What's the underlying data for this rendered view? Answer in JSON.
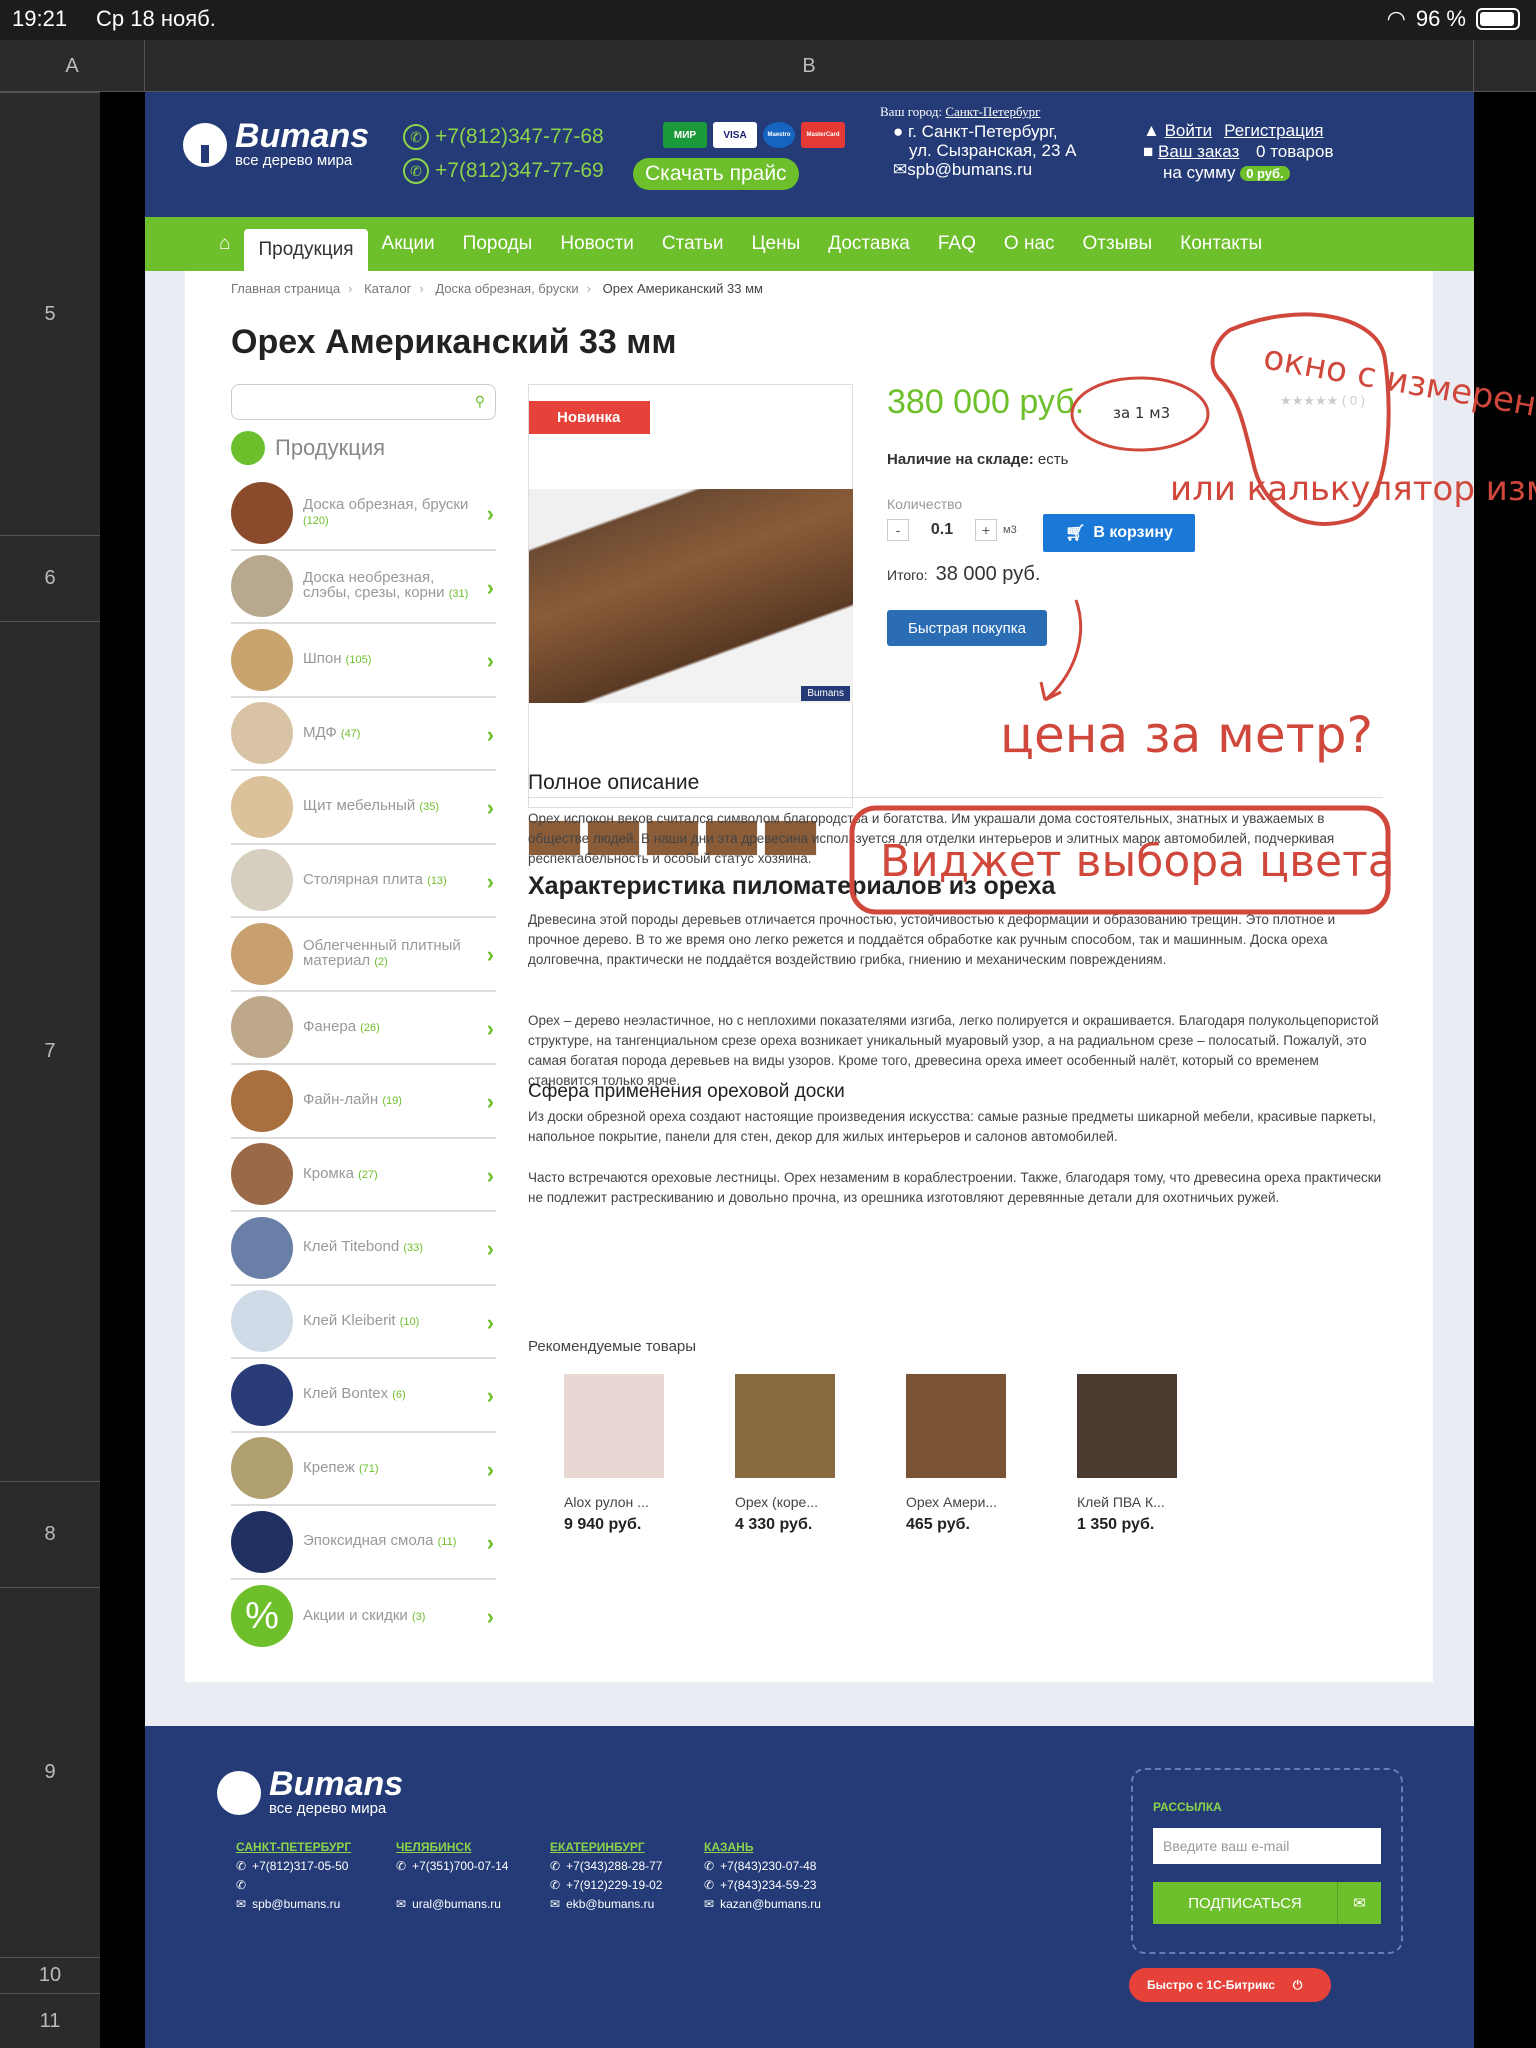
{
  "status_bar": {
    "time": "19:21",
    "date": "Ср 18 нояб.",
    "battery": "96 %"
  },
  "sheet": {
    "columns": [
      "A",
      "B"
    ],
    "rows": [
      "5",
      "6",
      "7",
      "8",
      "9",
      "10",
      "11"
    ]
  },
  "site": {
    "logo": {
      "name": "Bumans",
      "tagline": "все дерево мира"
    },
    "phones": [
      "+7(812)347-77-68",
      "+7(812)347-77-69"
    ],
    "payment_cards": [
      "МИР",
      "VISA",
      "Maestro",
      "MasterCard"
    ],
    "download_price": "Скачать прайс",
    "city_label": "Ваш город:",
    "city": "Санкт-Петербург",
    "address_line1": "г. Санкт-Петербург,",
    "address_line2": "ул. Сызранская, 23 А",
    "email": "spb@bumans.ru",
    "login": "Войти",
    "register": "Регистрация",
    "order_label": "Ваш заказ",
    "order_count": "0 товаров",
    "order_sum_label": "на сумму",
    "order_sum": "0 руб.",
    "nav": [
      "Продукция",
      "Акции",
      "Породы",
      "Новости",
      "Статьи",
      "Цены",
      "Доставка",
      "FAQ",
      "О нас",
      "Отзывы",
      "Контакты"
    ],
    "breadcrumbs": [
      "Главная страница",
      "Каталог",
      "Доска обрезная, бруски",
      "Орех Американский 33 мм"
    ],
    "title": "Орех Американский 33 мм",
    "catalog_title": "Продукция",
    "categories": [
      {
        "label": "Доска обрезная, бруски",
        "count": "(120)"
      },
      {
        "label": "Доска необрезная, слэбы, срезы, корни",
        "count": "(31)"
      },
      {
        "label": "Шпон",
        "count": "(105)"
      },
      {
        "label": "МДФ",
        "count": "(47)"
      },
      {
        "label": "Щит мебельный",
        "count": "(35)"
      },
      {
        "label": "Столярная плита",
        "count": "(13)"
      },
      {
        "label": "Облегченный плитный материал",
        "count": "(2)"
      },
      {
        "label": "Фанера",
        "count": "(26)"
      },
      {
        "label": "Файн-лайн",
        "count": "(19)"
      },
      {
        "label": "Кромка",
        "count": "(27)"
      },
      {
        "label": "Клей Titebond",
        "count": "(33)"
      },
      {
        "label": "Клей Kleiberit",
        "count": "(10)"
      },
      {
        "label": "Клей Bontex",
        "count": "(6)"
      },
      {
        "label": "Крепеж",
        "count": "(71)"
      },
      {
        "label": "Эпоксидная смола",
        "count": "(11)"
      },
      {
        "label": "Акции и скидки",
        "count": "(3)"
      }
    ],
    "badge_new": "Новинка",
    "watermark": "Bumans",
    "price": "380 000 руб.",
    "rating": "★★★★★ ( 0 )",
    "stock_label": "Наличие на складе:",
    "stock_value": "есть",
    "qty_label": "Количество",
    "qty_minus": "-",
    "qty_value": "0.1",
    "qty_plus": "+",
    "qty_unit": "м3",
    "cart_button": "В корзину",
    "total_label": "Итого:",
    "total_value": "38 000 руб.",
    "quick_buy": "Быстрая покупка",
    "desc_title": "Полное описание",
    "desc_p1": "Орех испокон веков считался символом благородства и богатства. Им украшали дома состоятельных, знатных и уважаемых в обществе людей. В наши дни эта древесина используется для отделки интерьеров и элитных марок автомобилей, подчеркивая респектабельность и особый статус хозяина.",
    "h2_char": "Характеристика пиломатериалов из ореха",
    "char_p1": "Древесина этой породы деревьев отличается прочностью, устойчивостью к деформации и образованию трещин. Это плотное и прочное дерево. В то же время оно легко режется и поддаётся обработке как ручным способом, так и машинным. Доска ореха долговечна, практически не поддаётся воздействию грибка, гниению и механическим повреждениям.",
    "char_p2": "Орех – дерево неэластичное, но с неплохими показателями изгиба, легко полируется и окрашивается. Благодаря полукольцепористой структуре, на тангенциальном срезе ореха возникает уникальный муаровый узор, а на радиальном срезе – полосатый. Пожалуй, это самая богатая порода деревьев на виды узоров. Кроме того, древесина ореха имеет особенный налёт, который со временем становится только ярче.",
    "h3_use": "Сфера применения ореховой доски",
    "use_p1": "Из доски обрезной ореха создают настоящие произведения искусства: самые разные предметы шикарной мебели, красивые паркеты, напольное покрытие, панели для стен, декор для жилых интерьеров и салонов автомобилей.",
    "use_p2": "Часто встречаются ореховые лестницы. Орех незаменим в кораблестроении. Также, благодаря тому, что древесина ореха практически не подлежит растрескиванию и довольно прочна, из орешника изготовляют деревянные детали для охотничьих ружей.",
    "rec_label": "Рекомендуемые товары",
    "recommended": [
      {
        "name": "Alox рулон ...",
        "price": "9 940 руб."
      },
      {
        "name": "Орех (коре...",
        "price": "4 330 руб."
      },
      {
        "name": "Орех Амери...",
        "price": "465 руб."
      },
      {
        "name": "Клей ПВА К...",
        "price": "1 350 руб."
      }
    ],
    "footer": {
      "logo_name": "Bumans",
      "logo_tagline": "все дерево мира",
      "offices": [
        {
          "city": "САНКТ-ПЕТЕРБУРГ",
          "phones": [
            "+7(812)317-05-50",
            ""
          ],
          "email": "spb@bumans.ru"
        },
        {
          "city": "ЧЕЛЯБИНСК",
          "phones": [
            "+7(351)700-07-14"
          ],
          "email": "ural@bumans.ru"
        },
        {
          "city": "ЕКАТЕРИНБУРГ",
          "phones": [
            "+7(343)288-28-77",
            "+7(912)229-19-02"
          ],
          "email": "ekb@bumans.ru"
        },
        {
          "city": "КАЗАНЬ",
          "phones": [
            "+7(843)230-07-48",
            "+7(843)234-59-23"
          ],
          "email": "kazan@bumans.ru"
        }
      ],
      "newsletter_title": "РАССЫЛКА",
      "newsletter_placeholder": "Введите ваш e-mail",
      "subscribe": "ПОДПИСАТЬСЯ",
      "bitrix": "Быстро с 1С-Битрикс"
    }
  },
  "annotations": {
    "note1": "окно с измерением",
    "note2": "или калькулятор измерений",
    "note_per": "за 1 м3",
    "note3": "цена за метр?",
    "note4": "Виджет выбора цвета"
  },
  "colors": {
    "brand_blue": "#243b77",
    "brand_green": "#6dbf2b",
    "price_green": "#6dbf2b",
    "annotation_red": "#d0483c",
    "cart_blue": "#1a78d6"
  }
}
